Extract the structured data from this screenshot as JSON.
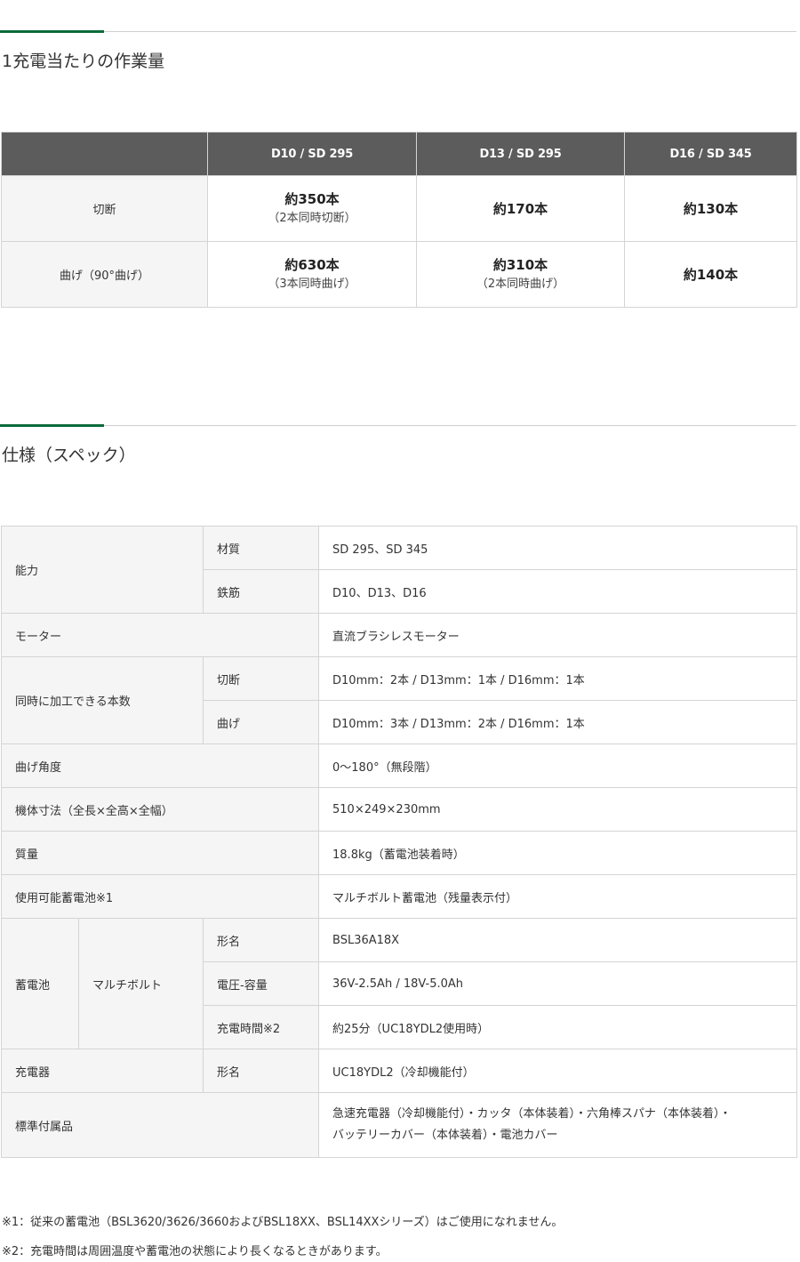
{
  "work_section": {
    "title": "1充電当たりの作業量",
    "columns": [
      "",
      "D10 / SD 295",
      "D13 / SD 295",
      "D16 / SD 345"
    ],
    "rows": [
      {
        "label": "切断",
        "cells": [
          {
            "main": "約350本",
            "sub": "（2本同時切断）"
          },
          {
            "main": "約170本",
            "sub": ""
          },
          {
            "main": "約130本",
            "sub": ""
          }
        ]
      },
      {
        "label": "曲げ（90°曲げ）",
        "cells": [
          {
            "main": "約630本",
            "sub": "（3本同時曲げ）"
          },
          {
            "main": "約310本",
            "sub": "（2本同時曲げ）"
          },
          {
            "main": "約140本",
            "sub": ""
          }
        ]
      }
    ]
  },
  "spec_section": {
    "title": "仕様（スペック）",
    "noryoku": "能力",
    "zaishitsu": "材質",
    "zaishitsu_val": "SD 295、SD 345",
    "tekkin": "鉄筋",
    "tekkin_val": "D10、D13、D16",
    "motor": "モーター",
    "motor_val": "直流ブラシレスモーター",
    "douji": "同時に加工できる本数",
    "setsudan": "切断",
    "setsudan_val": "D10mm：2本 / D13mm：1本 / D16mm：1本",
    "mage": "曲げ",
    "mage_val": "D10mm：3本 / D13mm：2本 / D16mm：1本",
    "mage_kakudo": "曲げ角度",
    "mage_kakudo_val": "0～180°（無段階）",
    "sunpou": "機体寸法（全長×全高×全幅）",
    "sunpou_val": "510×249×230mm",
    "shitsuryou": "質量",
    "shitsuryou_val": "18.8kg（蓄電池装着時）",
    "shiyou_battery": "使用可能蓄電池※1",
    "shiyou_battery_val": "マルチボルト蓄電池（残量表示付）",
    "battery": "蓄電池",
    "multivolt": "マルチボルト",
    "katamei": "形名",
    "katamei_val": "BSL36A18X",
    "denatsu": "電圧-容量",
    "denatsu_val": "36V-2.5Ah / 18V-5.0Ah",
    "juuden_jikan": "充電時間※2",
    "juuden_jikan_val": "約25分（UC18YDL2使用時）",
    "charger": "充電器",
    "charger_katamei": "形名",
    "charger_val": "UC18YDL2（冷却機能付）",
    "fuzoku": "標準付属品",
    "fuzoku_line1": "急速充電器（冷却機能付）・カッタ（本体装着）・六角棒スパナ（本体装着）・",
    "fuzoku_line2": "バッテリーカバー（本体装着）・電池カバー"
  },
  "notes": {
    "note1": "※1：従来の蓄電池（BSL3620/3626/3660およびBSL18XX、BSL14XXシリーズ）はご使用になれません。",
    "note2": "※2：充電時間は周囲温度や蓄電池の状態により長くなるときがあります。"
  },
  "colors": {
    "accent": "#0a6b3a",
    "header_bg": "#5c5c5c",
    "label_bg": "#f5f5f5"
  }
}
